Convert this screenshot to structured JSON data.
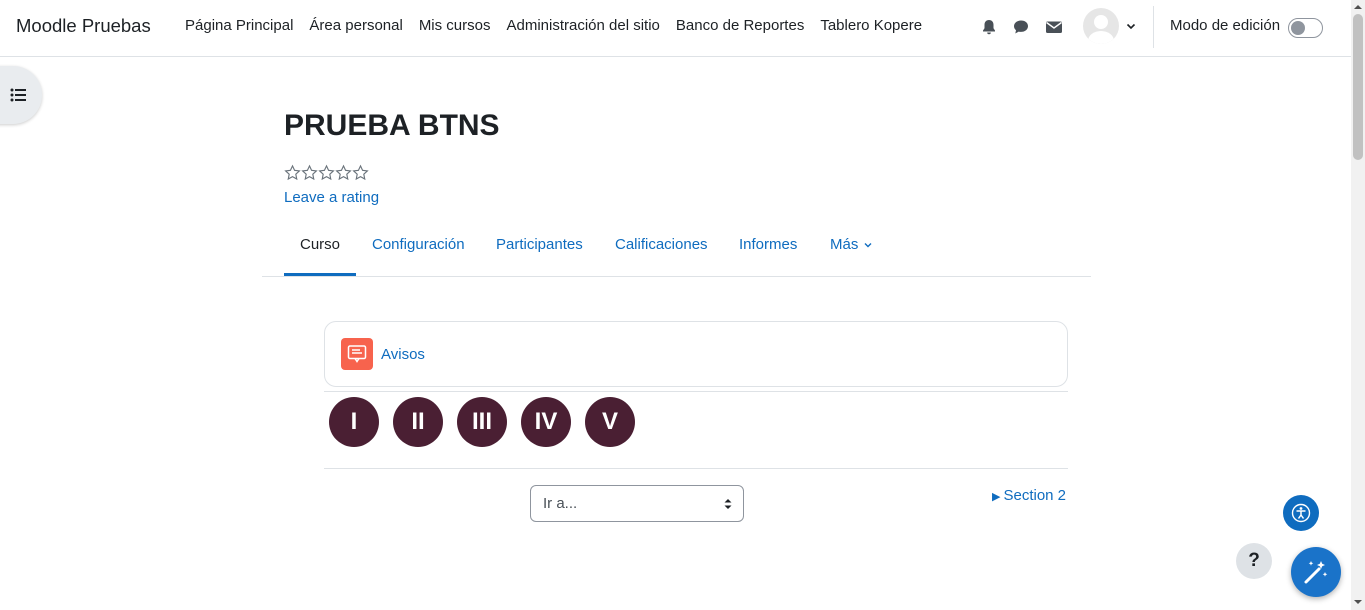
{
  "navbar": {
    "brand": "Moodle Pruebas",
    "items": [
      {
        "label": "Página Principal"
      },
      {
        "label": "Área personal"
      },
      {
        "label": "Mis cursos"
      },
      {
        "label": "Administración del sitio"
      },
      {
        "label": "Banco de Reportes"
      },
      {
        "label": "Tablero Kopere"
      }
    ],
    "edit_mode_label": "Modo de edición",
    "icons": [
      "bell-icon",
      "chat-icon",
      "envelope-icon",
      "avatar",
      "chevron-down-icon"
    ]
  },
  "course": {
    "title": "PRUEBA BTNS",
    "rating_link": "Leave a rating",
    "stars": 5
  },
  "secondary_nav": {
    "tabs": [
      {
        "label": "Curso",
        "active": true
      },
      {
        "label": "Configuración"
      },
      {
        "label": "Participantes"
      },
      {
        "label": "Calificaciones"
      },
      {
        "label": "Informes"
      },
      {
        "label": "Más"
      }
    ]
  },
  "content": {
    "activity": {
      "name": "Avisos",
      "icon": "forum-icon"
    },
    "buttons": [
      "I",
      "II",
      "III",
      "IV",
      "V"
    ],
    "jump_select": "Ir a...",
    "next_section": "Section 2"
  },
  "floating": {
    "help_label": "?"
  },
  "colors": {
    "link": "#0f6cbf",
    "roman_button": "#4a1f33",
    "activity_icon": "#f7634d"
  }
}
